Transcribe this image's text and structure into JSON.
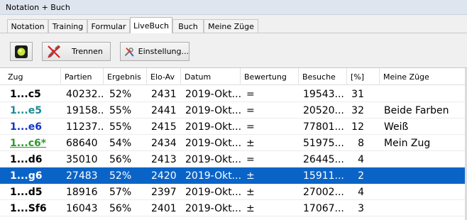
{
  "window": {
    "title": "Notation + Buch"
  },
  "tabs": [
    {
      "label": "Notation",
      "active": false
    },
    {
      "label": "Training",
      "active": false
    },
    {
      "label": "Formular",
      "active": false
    },
    {
      "label": "LiveBuch",
      "active": true
    },
    {
      "label": "Buch",
      "active": false
    },
    {
      "label": "Meine Züge",
      "active": false
    }
  ],
  "toolbar": {
    "status_icon": "status-light-icon",
    "trennen_label": "Trennen",
    "einstellung_label": "Einstellung..."
  },
  "colors": {
    "selection": "#0a64c8",
    "move_teal": "#1b8a94",
    "move_blue": "#1434c8",
    "move_green": "#2c9a2c"
  },
  "table": {
    "columns": [
      "Zug",
      "Partien",
      "Ergebnis",
      "Elo-Av",
      "Datum",
      "Bewertung",
      "Besuche",
      "[%]",
      "Meine Züge"
    ],
    "rows": [
      {
        "zug": "1...c5",
        "partien": "40232...",
        "ergebnis": "52%",
        "elo": "2431",
        "datum": "2019-Okt...",
        "bewertung": "=",
        "besuche": "19543...",
        "pct": "31",
        "meine": "",
        "color": "black",
        "selected": false
      },
      {
        "zug": "1...e5",
        "partien": "19158...",
        "ergebnis": "55%",
        "elo": "2441",
        "datum": "2019-Okt...",
        "bewertung": "=",
        "besuche": "20520...",
        "pct": "32",
        "meine": "Beide Farben",
        "color": "teal",
        "selected": false
      },
      {
        "zug": "1...e6",
        "partien": "11237...",
        "ergebnis": "55%",
        "elo": "2415",
        "datum": "2019-Okt...",
        "bewertung": "=",
        "besuche": "77801...",
        "pct": "12",
        "meine": "Weiß",
        "color": "blue",
        "selected": false
      },
      {
        "zug": "1...c6*",
        "partien": "68640",
        "ergebnis": "54%",
        "elo": "2434",
        "datum": "2019-Okt...",
        "bewertung": "±",
        "besuche": "51975...",
        "pct": "8",
        "meine": "Mein Zug",
        "color": "green",
        "selected": false
      },
      {
        "zug": "1...d6",
        "partien": "35010",
        "ergebnis": "56%",
        "elo": "2413",
        "datum": "2019-Okt...",
        "bewertung": "=",
        "besuche": "26445...",
        "pct": "4",
        "meine": "",
        "color": "black",
        "selected": false
      },
      {
        "zug": "1...g6",
        "partien": "27483",
        "ergebnis": "52%",
        "elo": "2420",
        "datum": "2019-Okt...",
        "bewertung": "±",
        "besuche": "15911...",
        "pct": "2",
        "meine": "",
        "color": "black",
        "selected": true
      },
      {
        "zug": "1...d5",
        "partien": "18916",
        "ergebnis": "57%",
        "elo": "2397",
        "datum": "2019-Okt...",
        "bewertung": "±",
        "besuche": "27002...",
        "pct": "4",
        "meine": "",
        "color": "black",
        "selected": false
      },
      {
        "zug": "1...Sf6",
        "partien": "16043",
        "ergebnis": "56%",
        "elo": "2401",
        "datum": "2019-Okt...",
        "bewertung": "±",
        "besuche": "17067...",
        "pct": "3",
        "meine": "",
        "color": "black",
        "selected": false
      }
    ]
  }
}
